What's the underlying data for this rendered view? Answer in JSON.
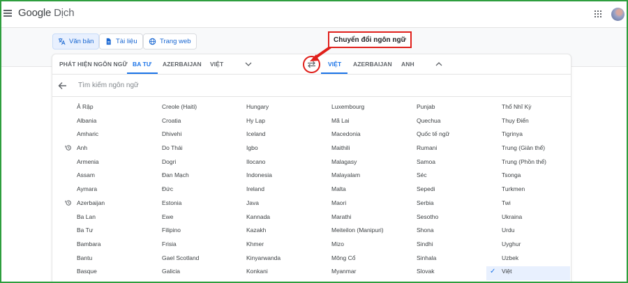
{
  "header": {
    "logo_google": "Google",
    "logo_product": "Dịch",
    "icons": [
      "menu-icon",
      "apps-icon",
      "avatar"
    ]
  },
  "modes": [
    {
      "label": "Văn bản",
      "icon": "translate-icon",
      "active": true
    },
    {
      "label": "Tài liệu",
      "icon": "document-icon",
      "active": false
    },
    {
      "label": "Trang web",
      "icon": "globe-icon",
      "active": false
    }
  ],
  "source_tabs": [
    "PHÁT HIỆN NGÔN NGỮ",
    "BA TƯ",
    "AZERBAIJAN",
    "VIỆT"
  ],
  "target_tabs": [
    "VIỆT",
    "AZERBAIJAN",
    "ANH"
  ],
  "callout": "Chuyển đổi ngôn ngữ",
  "search": {
    "placeholder": "Tìm kiếm ngôn ngữ"
  },
  "language_columns": [
    [
      {
        "name": "Ả Rập"
      },
      {
        "name": "Albania"
      },
      {
        "name": "Amharic"
      },
      {
        "name": "Anh",
        "recent": true
      },
      {
        "name": "Armenia"
      },
      {
        "name": "Assam"
      },
      {
        "name": "Aymara"
      },
      {
        "name": "Azerbaijan",
        "recent": true
      },
      {
        "name": "Ba Lan"
      },
      {
        "name": "Ba Tư"
      },
      {
        "name": "Bambara"
      },
      {
        "name": "Bantu"
      },
      {
        "name": "Basque"
      }
    ],
    [
      {
        "name": "Creole (Haiti)"
      },
      {
        "name": "Croatia"
      },
      {
        "name": "Dhivehi"
      },
      {
        "name": "Do Thái"
      },
      {
        "name": "Dogri"
      },
      {
        "name": "Đan Mạch"
      },
      {
        "name": "Đức"
      },
      {
        "name": "Estonia"
      },
      {
        "name": "Ewe"
      },
      {
        "name": "Filipino"
      },
      {
        "name": "Frisia"
      },
      {
        "name": "Gael Scotland"
      },
      {
        "name": "Galicia"
      }
    ],
    [
      {
        "name": "Hungary"
      },
      {
        "name": "Hy Lạp"
      },
      {
        "name": "Iceland"
      },
      {
        "name": "Igbo"
      },
      {
        "name": "Ilocano"
      },
      {
        "name": "Indonesia"
      },
      {
        "name": "Ireland"
      },
      {
        "name": "Java"
      },
      {
        "name": "Kannada"
      },
      {
        "name": "Kazakh"
      },
      {
        "name": "Khmer"
      },
      {
        "name": "Kinyarwanda"
      },
      {
        "name": "Konkani"
      }
    ],
    [
      {
        "name": "Luxembourg"
      },
      {
        "name": "Mã Lai"
      },
      {
        "name": "Macedonia"
      },
      {
        "name": "Maithili"
      },
      {
        "name": "Malagasy"
      },
      {
        "name": "Malayalam"
      },
      {
        "name": "Malta"
      },
      {
        "name": "Maori"
      },
      {
        "name": "Marathi"
      },
      {
        "name": "Meiteilon (Manipuri)"
      },
      {
        "name": "Mizo"
      },
      {
        "name": "Mông Cổ"
      },
      {
        "name": "Myanmar"
      }
    ],
    [
      {
        "name": "Punjab"
      },
      {
        "name": "Quechua"
      },
      {
        "name": "Quốc tế ngữ"
      },
      {
        "name": "Rumani"
      },
      {
        "name": "Samoa"
      },
      {
        "name": "Séc"
      },
      {
        "name": "Sepedi"
      },
      {
        "name": "Serbia"
      },
      {
        "name": "Sesotho"
      },
      {
        "name": "Shona"
      },
      {
        "name": "Sindhi"
      },
      {
        "name": "Sinhala"
      },
      {
        "name": "Slovak"
      }
    ],
    [
      {
        "name": "Thổ Nhĩ Kỳ"
      },
      {
        "name": "Thụy Điển"
      },
      {
        "name": "Tigrinya"
      },
      {
        "name": "Trung (Giản thể)"
      },
      {
        "name": "Trung (Phồn thể)"
      },
      {
        "name": "Tsonga"
      },
      {
        "name": "Turkmen"
      },
      {
        "name": "Twi"
      },
      {
        "name": "Ukraina"
      },
      {
        "name": "Urdu"
      },
      {
        "name": "Uyghur"
      },
      {
        "name": "Uzbek"
      },
      {
        "name": "Việt",
        "selected": true
      }
    ]
  ],
  "colors": {
    "accent": "#1a73e8",
    "callout_border": "#e0201b",
    "frame": "#2e9e3e"
  }
}
